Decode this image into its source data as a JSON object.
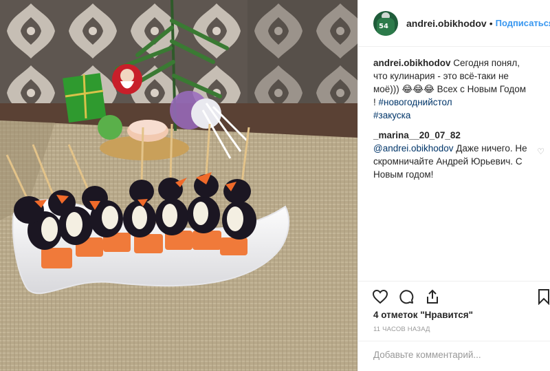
{
  "post": {
    "username": "andrei.obikhodov",
    "separator": "•",
    "follow_label": "Подписаться",
    "avatar_number": "54"
  },
  "comments": [
    {
      "author": "andrei.obikhodov",
      "text": " Сегодня понял, что кулинария - это всё-таки не моё))) 😂😂😂 Всех с Новым Годом ! ",
      "tags": [
        "#новогоднийстол",
        "#закуска"
      ]
    },
    {
      "author": "_marina__20_07_82",
      "mention": "@andrei.obikhodov",
      "text": " Даже ничего. Не скромничайте Андрей Юрьевич. С Новым годом!"
    }
  ],
  "icons": {
    "like": "heart-icon",
    "comment": "comment-bubble-icon",
    "share": "share-icon",
    "save": "bookmark-icon",
    "comment_like": "small-heart-icon"
  },
  "likes_text": "4 отметок \"Нравится\"",
  "time_text": "11 ЧАСОВ НАЗАД",
  "add_comment_placeholder": "Добавьте комментарий...",
  "colors": {
    "link": "#3897f0",
    "hashtag": "#003569",
    "muted": "#999999"
  }
}
